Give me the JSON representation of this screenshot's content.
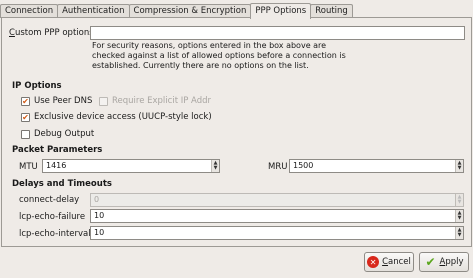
{
  "tabs": [
    {
      "label": "Connection"
    },
    {
      "label": "Authentication"
    },
    {
      "label": "Compression & Encryption"
    },
    {
      "label": "PPP Options"
    },
    {
      "label": "Routing"
    }
  ],
  "custom_ppp": {
    "label_u": "C",
    "label_rest": "ustom PPP options:",
    "value": "",
    "note": "For security reasons, options entered in the box above are checked against a list of allowed options before a connection is established.  Currently there are no options on the list."
  },
  "ip_options": {
    "heading": "IP Options",
    "use_peer_dns": {
      "label": "Use Peer DNS",
      "checked": true
    },
    "require_explicit_ip": {
      "label": "Require Explicit IP Addr",
      "checked": false,
      "enabled": false
    },
    "exclusive_device": {
      "label": "Exclusive device access (UUCP-style lock)",
      "checked": true
    },
    "debug_output": {
      "label": "Debug Output",
      "checked": false
    }
  },
  "packet_parameters": {
    "heading": "Packet Parameters",
    "mtu_label": "MTU",
    "mtu_value": "1416",
    "mru_label": "MRU",
    "mru_value": "1500"
  },
  "delays": {
    "heading": "Delays and Timeouts",
    "connect_delay_label": "connect-delay",
    "connect_delay_value": "0",
    "lcp_echo_failure_label": "lcp-echo-failure",
    "lcp_echo_failure_value": "10",
    "lcp_echo_interval_label": "lcp-echo-interval",
    "lcp_echo_interval_value": "10"
  },
  "buttons": {
    "cancel_u": "C",
    "cancel_rest": "ancel",
    "apply_u": "A",
    "apply_rest": "pply"
  },
  "colors": {
    "check_mark": "#d05a16",
    "cancel_icon": "#d8281c",
    "apply_icon": "#5aa61c"
  }
}
